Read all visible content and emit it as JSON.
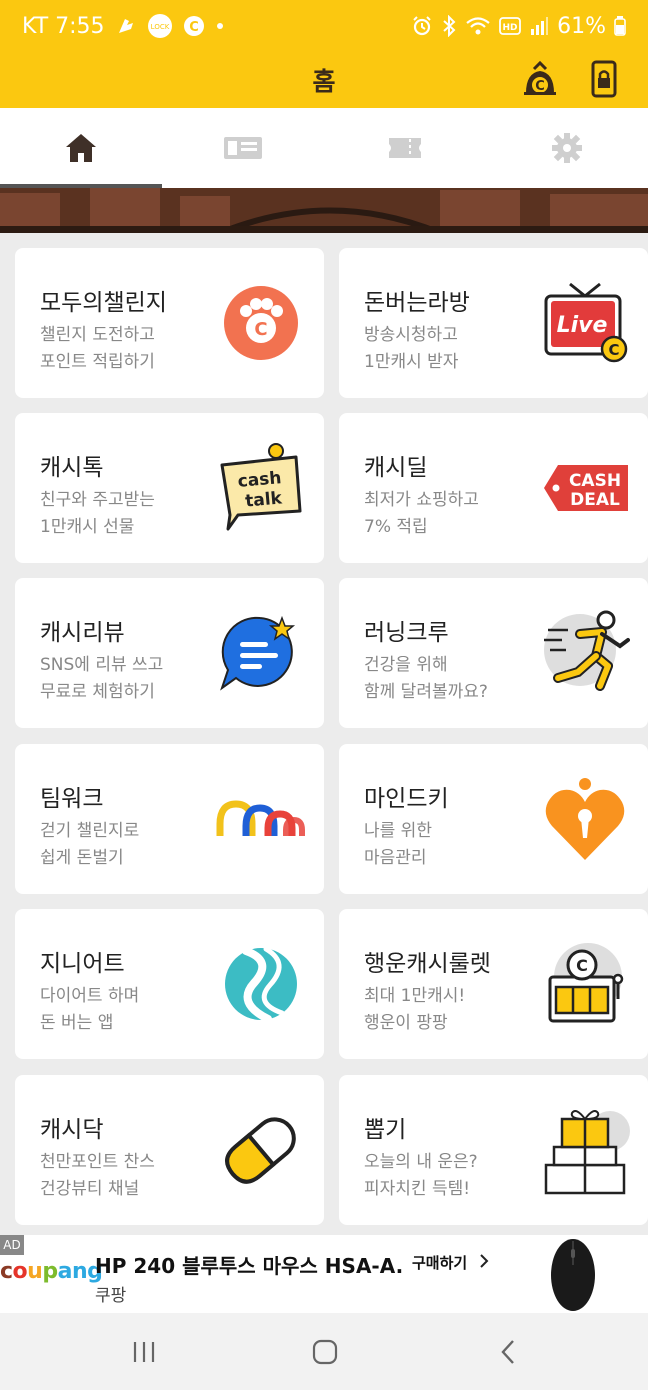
{
  "status_bar": {
    "carrier_time": "KT 7:55",
    "battery": "61%",
    "lock_label": "LOCK"
  },
  "header": {
    "title": "홈"
  },
  "tabs": [
    {
      "icon": "home-icon",
      "active": true
    },
    {
      "icon": "coupon-icon",
      "active": false
    },
    {
      "icon": "ticket-icon",
      "active": false
    },
    {
      "icon": "settings-icon",
      "active": false
    }
  ],
  "cards": [
    {
      "title": "모두의챌린지",
      "desc1": "챌린지 도전하고",
      "desc2": "포인트 적립하기",
      "icon": "paw-coin-icon"
    },
    {
      "title": "돈버는라방",
      "desc1": "방송시청하고",
      "desc2": "1만캐시 받자",
      "icon": "live-tv-icon",
      "icon_text": "Live"
    },
    {
      "title": "캐시톡",
      "desc1": "친구와 주고받는",
      "desc2": "1만캐시 선물",
      "icon": "cash-talk-icon",
      "icon_text1": "cash",
      "icon_text2": "talk"
    },
    {
      "title": "캐시딜",
      "desc1": "최저가 쇼핑하고",
      "desc2": "7% 적립",
      "icon": "cash-deal-tag-icon",
      "icon_text1": "CASH",
      "icon_text2": "DEAL"
    },
    {
      "title": "캐시리뷰",
      "desc1": "SNS에 리뷰 쓰고",
      "desc2": "무료로 체험하기",
      "icon": "review-bubble-icon"
    },
    {
      "title": "러닝크루",
      "desc1": "건강을 위해",
      "desc2": "함께 달려볼까요?",
      "icon": "runner-icon"
    },
    {
      "title": "팀워크",
      "desc1": "걷기 챌린지로",
      "desc2": "쉽게 돈벌기",
      "icon": "teamwork-arches-icon"
    },
    {
      "title": "마인드키",
      "desc1": "나를 위한",
      "desc2": "마음관리",
      "icon": "heart-keyhole-icon"
    },
    {
      "title": "지니어트",
      "desc1": "다이어트 하며",
      "desc2": "돈 버는 앱",
      "icon": "ginieat-wave-icon"
    },
    {
      "title": "행운캐시룰렛",
      "desc1": "최대 1만캐시!",
      "desc2": "행운이 팡팡",
      "icon": "slot-machine-icon"
    },
    {
      "title": "캐시닥",
      "desc1": "천만포인트 찬스",
      "desc2": "건강뷰티 채널",
      "icon": "pill-icon"
    },
    {
      "title": "뽑기",
      "desc1": "오늘의 내 운은?",
      "desc2": "피자치킨 득템!",
      "icon": "gift-boxes-icon"
    }
  ],
  "ad": {
    "tag": "AD",
    "brand": "coupang",
    "title": "HP 240 블루투스 마우스 HSA-A...",
    "subtitle": "쿠팡",
    "cta": "구매하기",
    "image": "mouse-product-icon"
  },
  "colors": {
    "accent": "#fbc810",
    "coral": "#f27250",
    "live_red": "#e23b3b",
    "deal_red": "#e0403a",
    "blue": "#1f6fe0",
    "orange": "#f9931f",
    "teal": "#3cbcc4"
  }
}
